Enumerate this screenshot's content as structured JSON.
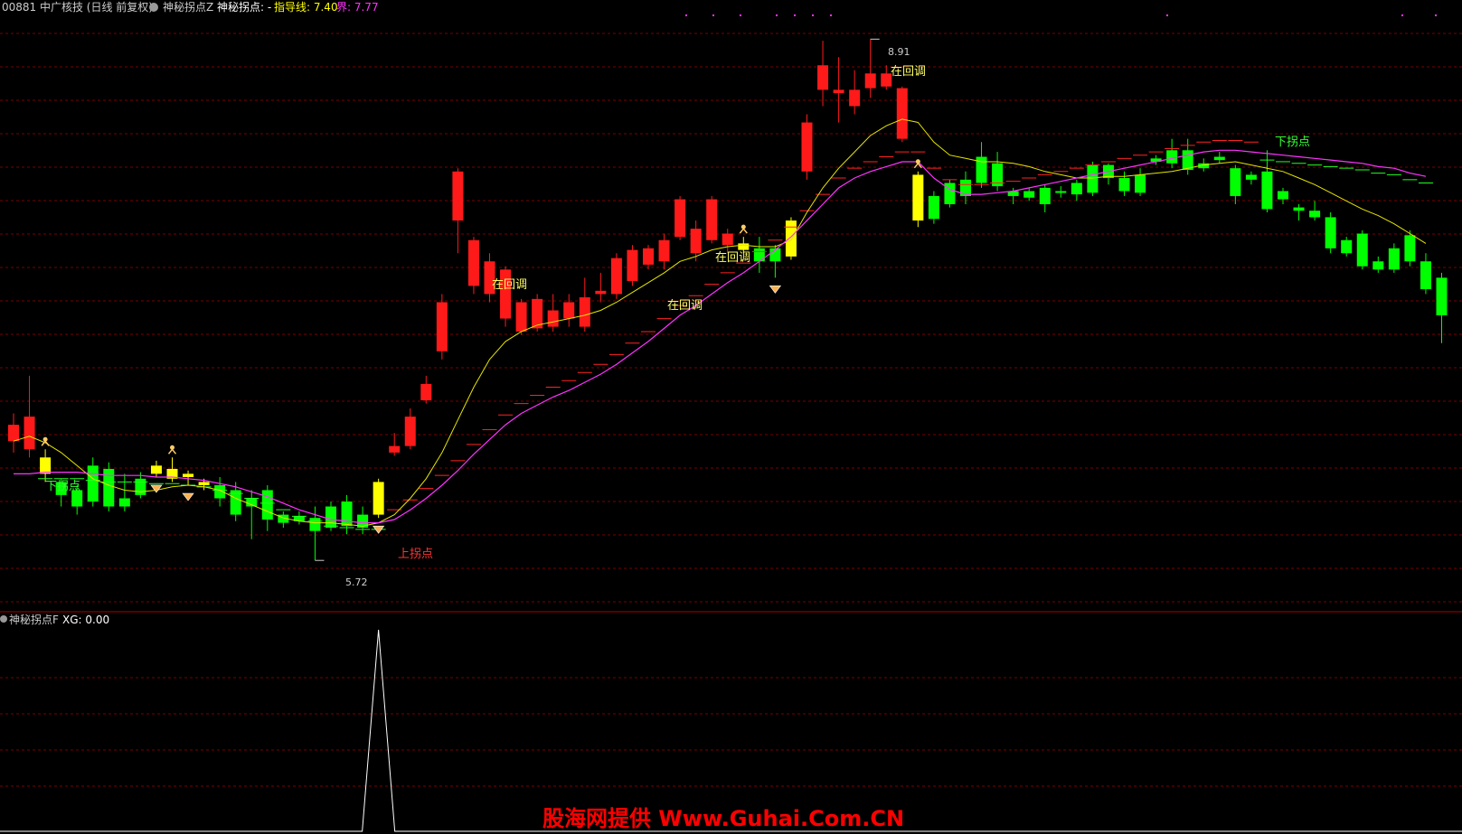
{
  "header": {
    "stock_label": "00881 中广核技 (日线 前复权)",
    "indicator_name": "神秘拐点Z",
    "indicator_value_label": "神秘拐点: -",
    "guide_label": "指导线: 7.40",
    "boundary_label": "界: 7.77"
  },
  "sub_header": {
    "indicator_name": "神秘拐点F",
    "xg_label": "XG: 0.00"
  },
  "watermark": "股海网提供 Www.Guhai.Com.CN",
  "annotations": {
    "high_price": "8.91",
    "low_price": "5.72",
    "pullback_1": "在回调",
    "pullback_2": "在回调",
    "pullback_3": "在回调",
    "pullback_4": "在回调",
    "down_turn_1": "下拐点",
    "down_turn_2": "下拐点",
    "up_turn": "上拐点"
  },
  "colors": {
    "background": "#000000",
    "grid": "#7a0000",
    "rise": "#ff1a1a",
    "fall": "#00ff00",
    "signal": "#ffff00",
    "guide_line": "#e6e600",
    "boundary_line": "#ff33ff",
    "label_yellow": "#ffff66",
    "label_green": "#33ff33",
    "label_red": "#ff3333",
    "watermark": "#ff0000"
  },
  "chart_data": {
    "type": "candlestick",
    "price_range": [
      5.5,
      9.05
    ],
    "candles": [
      {
        "o": 6.55,
        "c": 6.45,
        "h": 6.62,
        "l": 6.38,
        "color": "red"
      },
      {
        "o": 6.4,
        "c": 6.6,
        "h": 6.85,
        "l": 6.35,
        "color": "red"
      },
      {
        "o": 6.35,
        "c": 6.25,
        "h": 6.4,
        "l": 6.2,
        "color": "signal"
      },
      {
        "o": 6.2,
        "c": 6.12,
        "h": 6.22,
        "l": 6.05,
        "color": "green"
      },
      {
        "o": 6.15,
        "c": 6.05,
        "h": 6.18,
        "l": 6.0,
        "color": "green"
      },
      {
        "o": 6.3,
        "c": 6.08,
        "h": 6.35,
        "l": 6.05,
        "color": "green"
      },
      {
        "o": 6.28,
        "c": 6.05,
        "h": 6.32,
        "l": 6.02,
        "color": "green"
      },
      {
        "o": 6.1,
        "c": 6.05,
        "h": 6.25,
        "l": 6.02,
        "color": "green"
      },
      {
        "o": 6.22,
        "c": 6.12,
        "h": 6.26,
        "l": 6.1,
        "color": "green"
      },
      {
        "o": 6.3,
        "c": 6.25,
        "h": 6.33,
        "l": 6.23,
        "color": "signal"
      },
      {
        "o": 6.28,
        "c": 6.22,
        "h": 6.35,
        "l": 6.2,
        "color": "signal"
      },
      {
        "o": 6.25,
        "c": 6.23,
        "h": 6.27,
        "l": 6.18,
        "color": "signal"
      },
      {
        "o": 6.2,
        "c": 6.18,
        "h": 6.22,
        "l": 6.15,
        "color": "signal"
      },
      {
        "o": 6.18,
        "c": 6.1,
        "h": 6.23,
        "l": 6.05,
        "color": "green"
      },
      {
        "o": 6.15,
        "c": 6.0,
        "h": 6.2,
        "l": 5.96,
        "color": "green"
      },
      {
        "o": 6.1,
        "c": 6.05,
        "h": 6.15,
        "l": 5.85,
        "color": "green"
      },
      {
        "o": 6.15,
        "c": 5.97,
        "h": 6.18,
        "l": 5.9,
        "color": "green"
      },
      {
        "o": 6.0,
        "c": 5.95,
        "h": 6.02,
        "l": 5.92,
        "color": "green"
      },
      {
        "o": 5.99,
        "c": 5.96,
        "h": 6.02,
        "l": 5.94,
        "color": "green"
      },
      {
        "o": 5.98,
        "c": 5.9,
        "h": 6.05,
        "l": 5.72,
        "color": "green"
      },
      {
        "o": 6.05,
        "c": 5.92,
        "h": 6.08,
        "l": 5.9,
        "color": "green"
      },
      {
        "o": 6.08,
        "c": 5.93,
        "h": 6.12,
        "l": 5.88,
        "color": "green"
      },
      {
        "o": 6.0,
        "c": 5.92,
        "h": 6.05,
        "l": 5.88,
        "color": "green"
      },
      {
        "o": 6.0,
        "c": 6.2,
        "h": 6.22,
        "l": 5.98,
        "color": "signal"
      },
      {
        "o": 6.38,
        "c": 6.42,
        "h": 6.5,
        "l": 6.36,
        "color": "red"
      },
      {
        "o": 6.42,
        "c": 6.6,
        "h": 6.65,
        "l": 6.4,
        "color": "red"
      },
      {
        "o": 6.7,
        "c": 6.8,
        "h": 6.85,
        "l": 6.68,
        "color": "red"
      },
      {
        "o": 7.0,
        "c": 7.3,
        "h": 7.35,
        "l": 6.95,
        "color": "red"
      },
      {
        "o": 7.8,
        "c": 8.1,
        "h": 8.12,
        "l": 7.6,
        "color": "red"
      },
      {
        "o": 7.4,
        "c": 7.68,
        "h": 7.7,
        "l": 7.35,
        "color": "red"
      },
      {
        "o": 7.35,
        "c": 7.55,
        "h": 7.6,
        "l": 7.3,
        "color": "red"
      },
      {
        "o": 7.2,
        "c": 7.5,
        "h": 7.52,
        "l": 7.15,
        "color": "red"
      },
      {
        "o": 7.12,
        "c": 7.3,
        "h": 7.32,
        "l": 7.1,
        "color": "red"
      },
      {
        "o": 7.14,
        "c": 7.32,
        "h": 7.35,
        "l": 7.12,
        "color": "red"
      },
      {
        "o": 7.15,
        "c": 7.25,
        "h": 7.35,
        "l": 7.12,
        "color": "red"
      },
      {
        "o": 7.2,
        "c": 7.3,
        "h": 7.35,
        "l": 7.15,
        "color": "red"
      },
      {
        "o": 7.15,
        "c": 7.33,
        "h": 7.45,
        "l": 7.12,
        "color": "red"
      },
      {
        "o": 7.35,
        "c": 7.37,
        "h": 7.48,
        "l": 7.3,
        "color": "red"
      },
      {
        "o": 7.35,
        "c": 7.57,
        "h": 7.6,
        "l": 7.32,
        "color": "red"
      },
      {
        "o": 7.43,
        "c": 7.62,
        "h": 7.65,
        "l": 7.4,
        "color": "red"
      },
      {
        "o": 7.53,
        "c": 7.63,
        "h": 7.65,
        "l": 7.5,
        "color": "red"
      },
      {
        "o": 7.55,
        "c": 7.68,
        "h": 7.72,
        "l": 7.5,
        "color": "red"
      },
      {
        "o": 7.7,
        "c": 7.93,
        "h": 7.95,
        "l": 7.68,
        "color": "red"
      },
      {
        "o": 7.6,
        "c": 7.75,
        "h": 7.8,
        "l": 7.55,
        "color": "red"
      },
      {
        "o": 7.68,
        "c": 7.93,
        "h": 7.95,
        "l": 7.66,
        "color": "red"
      },
      {
        "o": 7.65,
        "c": 7.72,
        "h": 7.75,
        "l": 7.6,
        "color": "red"
      },
      {
        "o": 7.62,
        "c": 7.66,
        "h": 7.7,
        "l": 7.6,
        "color": "signal"
      },
      {
        "o": 7.63,
        "c": 7.55,
        "h": 7.7,
        "l": 7.48,
        "color": "green"
      },
      {
        "o": 7.63,
        "c": 7.55,
        "h": 7.65,
        "l": 7.45,
        "color": "green"
      },
      {
        "o": 7.58,
        "c": 7.8,
        "h": 7.82,
        "l": 7.56,
        "color": "signal"
      },
      {
        "o": 8.1,
        "c": 8.4,
        "h": 8.45,
        "l": 8.05,
        "color": "red"
      },
      {
        "o": 8.6,
        "c": 8.75,
        "h": 8.9,
        "l": 8.5,
        "color": "red"
      },
      {
        "o": 8.58,
        "c": 8.6,
        "h": 8.8,
        "l": 8.4,
        "color": "red"
      },
      {
        "o": 8.5,
        "c": 8.6,
        "h": 8.72,
        "l": 8.45,
        "color": "red"
      },
      {
        "o": 8.61,
        "c": 8.7,
        "h": 8.91,
        "l": 8.55,
        "color": "red"
      },
      {
        "o": 8.62,
        "c": 8.7,
        "h": 8.75,
        "l": 8.6,
        "color": "red"
      },
      {
        "o": 8.3,
        "c": 8.61,
        "h": 8.62,
        "l": 8.28,
        "color": "red"
      },
      {
        "o": 8.08,
        "c": 7.8,
        "h": 8.1,
        "l": 7.76,
        "color": "signal"
      },
      {
        "o": 7.95,
        "c": 7.81,
        "h": 7.98,
        "l": 7.78,
        "color": "green"
      },
      {
        "o": 8.03,
        "c": 7.9,
        "h": 8.05,
        "l": 7.88,
        "color": "green"
      },
      {
        "o": 8.05,
        "c": 7.95,
        "h": 8.1,
        "l": 7.9,
        "color": "green"
      },
      {
        "o": 8.19,
        "c": 8.03,
        "h": 8.28,
        "l": 8.0,
        "color": "green"
      },
      {
        "o": 8.15,
        "c": 8.01,
        "h": 8.22,
        "l": 7.98,
        "color": "green"
      },
      {
        "o": 7.98,
        "c": 7.95,
        "h": 8.0,
        "l": 7.9,
        "color": "green"
      },
      {
        "o": 7.98,
        "c": 7.94,
        "h": 8.0,
        "l": 7.92,
        "color": "green"
      },
      {
        "o": 8.0,
        "c": 7.9,
        "h": 8.02,
        "l": 7.85,
        "color": "green"
      },
      {
        "o": 7.98,
        "c": 7.97,
        "h": 8.01,
        "l": 7.94,
        "color": "green"
      },
      {
        "o": 8.03,
        "c": 7.96,
        "h": 8.05,
        "l": 7.92,
        "color": "green"
      },
      {
        "o": 8.14,
        "c": 7.97,
        "h": 8.16,
        "l": 7.95,
        "color": "green"
      },
      {
        "o": 8.14,
        "c": 8.06,
        "h": 8.15,
        "l": 8.02,
        "color": "green"
      },
      {
        "o": 8.06,
        "c": 7.98,
        "h": 8.1,
        "l": 7.95,
        "color": "green"
      },
      {
        "o": 8.08,
        "c": 7.97,
        "h": 8.12,
        "l": 7.95,
        "color": "green"
      },
      {
        "o": 8.18,
        "c": 8.16,
        "h": 8.2,
        "l": 8.14,
        "color": "green"
      },
      {
        "o": 8.23,
        "c": 8.15,
        "h": 8.3,
        "l": 8.12,
        "color": "green"
      },
      {
        "o": 8.23,
        "c": 8.11,
        "h": 8.3,
        "l": 8.08,
        "color": "green"
      },
      {
        "o": 8.15,
        "c": 8.12,
        "h": 8.18,
        "l": 8.1,
        "color": "green"
      },
      {
        "o": 8.19,
        "c": 8.17,
        "h": 8.22,
        "l": 8.15,
        "color": "green"
      },
      {
        "o": 8.12,
        "c": 7.95,
        "h": 8.14,
        "l": 7.9,
        "color": "green"
      },
      {
        "o": 8.08,
        "c": 8.05,
        "h": 8.1,
        "l": 8.02,
        "color": "green"
      },
      {
        "o": 8.1,
        "c": 7.87,
        "h": 8.23,
        "l": 7.85,
        "color": "green"
      },
      {
        "o": 7.98,
        "c": 7.93,
        "h": 8.0,
        "l": 7.9,
        "color": "green"
      },
      {
        "o": 7.88,
        "c": 7.86,
        "h": 7.9,
        "l": 7.8,
        "color": "green"
      },
      {
        "o": 7.86,
        "c": 7.82,
        "h": 7.92,
        "l": 7.8,
        "color": "green"
      },
      {
        "o": 7.82,
        "c": 7.63,
        "h": 7.85,
        "l": 7.6,
        "color": "green"
      },
      {
        "o": 7.68,
        "c": 7.6,
        "h": 7.7,
        "l": 7.58,
        "color": "green"
      },
      {
        "o": 7.72,
        "c": 7.52,
        "h": 7.74,
        "l": 7.5,
        "color": "green"
      },
      {
        "o": 7.55,
        "c": 7.5,
        "h": 7.58,
        "l": 7.48,
        "color": "green"
      },
      {
        "o": 7.63,
        "c": 7.5,
        "h": 7.66,
        "l": 7.48,
        "color": "green"
      },
      {
        "o": 7.71,
        "c": 7.55,
        "h": 7.74,
        "l": 7.52,
        "color": "green"
      },
      {
        "o": 7.55,
        "c": 7.38,
        "h": 7.6,
        "l": 7.35,
        "color": "green"
      },
      {
        "o": 7.45,
        "c": 7.22,
        "h": 7.48,
        "l": 7.05,
        "color": "green"
      }
    ],
    "series": [
      {
        "name": "指导线",
        "values": [
          6.45,
          6.48,
          6.44,
          6.38,
          6.3,
          6.22,
          6.18,
          6.15,
          6.14,
          6.15,
          6.17,
          6.18,
          6.17,
          6.15,
          6.1,
          6.06,
          6.02,
          5.98,
          5.96,
          5.95,
          5.95,
          5.94,
          5.93,
          5.95,
          6.0,
          6.1,
          6.22,
          6.38,
          6.58,
          6.78,
          6.95,
          7.06,
          7.12,
          7.16,
          7.18,
          7.2,
          7.22,
          7.25,
          7.3,
          7.36,
          7.42,
          7.48,
          7.55,
          7.58,
          7.62,
          7.64,
          7.65,
          7.64,
          7.64,
          7.68,
          7.85,
          8.0,
          8.12,
          8.22,
          8.32,
          8.38,
          8.42,
          8.4,
          8.28,
          8.2,
          8.18,
          8.16,
          8.16,
          8.15,
          8.13,
          8.1,
          8.08,
          8.06,
          8.06,
          8.07,
          8.07,
          8.08,
          8.09,
          8.1,
          8.12,
          8.14,
          8.15,
          8.16,
          8.14,
          8.12,
          8.1,
          8.06,
          8.02,
          7.97,
          7.92,
          7.87,
          7.83,
          7.78,
          7.72,
          7.66
        ]
      },
      {
        "name": "界",
        "values": [
          6.25,
          6.25,
          6.26,
          6.26,
          6.26,
          6.25,
          6.24,
          6.24,
          6.24,
          6.23,
          6.23,
          6.22,
          6.21,
          6.19,
          6.17,
          6.14,
          6.11,
          6.07,
          6.03,
          6.0,
          5.97,
          5.96,
          5.95,
          5.95,
          5.97,
          6.03,
          6.1,
          6.18,
          6.27,
          6.37,
          6.46,
          6.55,
          6.62,
          6.67,
          6.72,
          6.76,
          6.81,
          6.86,
          6.92,
          6.99,
          7.06,
          7.14,
          7.22,
          7.28,
          7.35,
          7.42,
          7.48,
          7.55,
          7.62,
          7.7,
          7.8,
          7.9,
          8.0,
          8.06,
          8.1,
          8.13,
          8.16,
          8.16,
          8.06,
          7.99,
          7.96,
          7.96,
          7.97,
          7.98,
          8.0,
          8.02,
          8.04,
          8.06,
          8.08,
          8.1,
          8.12,
          8.14,
          8.16,
          8.18,
          8.2,
          8.22,
          8.23,
          8.23,
          8.22,
          8.21,
          8.2,
          8.19,
          8.18,
          8.17,
          8.16,
          8.15,
          8.13,
          8.12,
          8.09,
          8.07
        ]
      }
    ],
    "sub_chart": {
      "range": [
        0,
        1
      ],
      "spike_index": 23,
      "value_at_spike": 1
    }
  }
}
